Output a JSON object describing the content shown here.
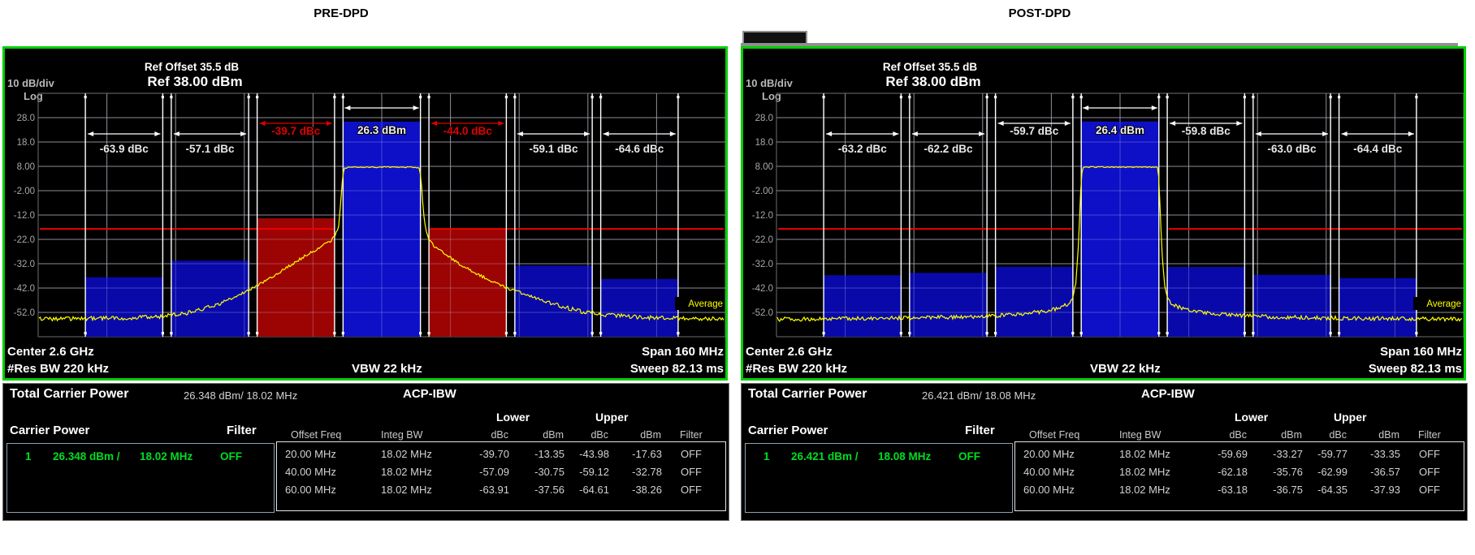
{
  "titles": {
    "left": "PRE-DPD",
    "right": "POST-DPD"
  },
  "panels": [
    {
      "name": "pre-dpd",
      "header": {
        "div_label": "10 dB/div",
        "scale_label": "Log",
        "ref_offset": "Ref Offset 35.5 dB",
        "ref": "Ref 38.00 dBm"
      },
      "y_ticks": [
        "28.0",
        "18.0",
        "8.00",
        "-2.00",
        "-12.0",
        "-22.0",
        "-32.0",
        "-42.0",
        "-52.0"
      ],
      "average_label": "Average",
      "footer": {
        "center": "Center  2.6 GHz",
        "res_bw": "#Res BW  220 kHz",
        "vbw": "VBW  22 kHz",
        "span": "Span 160 MHz",
        "sweep": "Sweep  82.13 ms"
      },
      "table": {
        "total_label": "Total Carrier Power",
        "total_value": "26.348 dBm/ 18.02 MHz",
        "acp_label": "ACP-IBW",
        "carrier_header": "Carrier Power",
        "filter_header": "Filter",
        "lower_header": "Lower",
        "upper_header": "Upper",
        "columns": [
          "Offset Freq",
          "Integ BW",
          "dBc",
          "dBm",
          "dBc",
          "dBm",
          "Filter"
        ],
        "carrier_row": {
          "index": "1",
          "power": "26.348 dBm /",
          "bw": "18.02 MHz",
          "filter": "OFF"
        },
        "rows": [
          [
            "20.00 MHz",
            "18.02 MHz",
            "-39.70",
            "-13.35",
            "-43.98",
            "-17.63",
            "OFF"
          ],
          [
            "40.00 MHz",
            "18.02 MHz",
            "-57.09",
            "-30.75",
            "-59.12",
            "-32.78",
            "OFF"
          ],
          [
            "60.00 MHz",
            "18.02 MHz",
            "-63.91",
            "-37.56",
            "-64.61",
            "-38.26",
            "OFF"
          ]
        ]
      }
    },
    {
      "name": "post-dpd",
      "header": {
        "div_label": "10 dB/div",
        "scale_label": "Log",
        "ref_offset": "Ref Offset 35.5 dB",
        "ref": "Ref 38.00 dBm"
      },
      "y_ticks": [
        "28.0",
        "18.0",
        "8.00",
        "-2.00",
        "-12.0",
        "-22.0",
        "-32.0",
        "-42.0",
        "-52.0"
      ],
      "average_label": "Average",
      "footer": {
        "center": "Center  2.6 GHz",
        "res_bw": "#Res BW  220 kHz",
        "vbw": "VBW  22 kHz",
        "span": "Span 160 MHz",
        "sweep": "Sweep  82.13 ms"
      },
      "table": {
        "total_label": "Total Carrier Power",
        "total_value": "26.421 dBm/ 18.08 MHz",
        "acp_label": "ACP-IBW",
        "carrier_header": "Carrier Power",
        "filter_header": "Filter",
        "lower_header": "Lower",
        "upper_header": "Upper",
        "columns": [
          "Offset Freq",
          "Integ BW",
          "dBc",
          "dBm",
          "dBc",
          "dBm",
          "Filter"
        ],
        "carrier_row": {
          "index": "1",
          "power": "26.421 dBm /",
          "bw": "18.08 MHz",
          "filter": "OFF"
        },
        "rows": [
          [
            "20.00 MHz",
            "18.02 MHz",
            "-59.69",
            "-33.27",
            "-59.77",
            "-33.35",
            "OFF"
          ],
          [
            "40.00 MHz",
            "18.02 MHz",
            "-62.18",
            "-35.76",
            "-62.99",
            "-36.57",
            "OFF"
          ],
          [
            "60.00 MHz",
            "18.02 MHz",
            "-63.18",
            "-36.75",
            "-64.35",
            "-37.93",
            "OFF"
          ]
        ]
      }
    }
  ],
  "chart_data": [
    {
      "type": "area",
      "title": "PRE-DPD ACP spectrum",
      "ref_dbm": 38.0,
      "db_per_div": 10,
      "span_mhz": 160,
      "center_freq": "2.6 GHz",
      "ylim": [
        -62,
        38
      ],
      "carrier": {
        "power_dbm": 26.348,
        "width_mhz": 18.02,
        "label": "26.3 dBm"
      },
      "offsets": [
        {
          "offset_mhz": -60,
          "label": "-63.9 dBc",
          "dbm": -37.56,
          "alarm": false
        },
        {
          "offset_mhz": -40,
          "label": "-57.1 dBc",
          "dbm": -30.75,
          "alarm": false
        },
        {
          "offset_mhz": -20,
          "label": "-39.7 dBc",
          "dbm": -13.35,
          "alarm": true
        },
        {
          "offset_mhz": 20,
          "label": "-44.0 dBc",
          "dbm": -17.63,
          "alarm": true
        },
        {
          "offset_mhz": 40,
          "label": "-59.1 dBc",
          "dbm": -32.78,
          "alarm": false
        },
        {
          "offset_mhz": 60,
          "label": "-64.6 dBc",
          "dbm": -38.26,
          "alarm": false
        }
      ],
      "limit_line_dbm": -17.7,
      "trace": [
        [
          -80,
          -54.8
        ],
        [
          -70,
          -54.5
        ],
        [
          -60,
          -54.3
        ],
        [
          -52,
          -53.8
        ],
        [
          -46,
          -52.5
        ],
        [
          -42,
          -51
        ],
        [
          -38,
          -48.5
        ],
        [
          -34,
          -45.5
        ],
        [
          -30,
          -42
        ],
        [
          -26,
          -38
        ],
        [
          -22,
          -33.5
        ],
        [
          -18,
          -29
        ],
        [
          -15,
          -26
        ],
        [
          -12,
          -22.8
        ],
        [
          -10.8,
          -20.5
        ],
        [
          -10,
          -16
        ],
        [
          -9.6,
          -8
        ],
        [
          -9.2,
          2
        ],
        [
          -8.8,
          7
        ],
        [
          -8,
          7.6
        ],
        [
          0,
          7.7
        ],
        [
          8,
          7.6
        ],
        [
          8.8,
          7
        ],
        [
          9.2,
          2
        ],
        [
          9.6,
          -8
        ],
        [
          10,
          -16
        ],
        [
          10.8,
          -21
        ],
        [
          12,
          -24.5
        ],
        [
          15,
          -28.5
        ],
        [
          18,
          -32
        ],
        [
          22,
          -36
        ],
        [
          26,
          -39.5
        ],
        [
          30,
          -42.5
        ],
        [
          34,
          -45
        ],
        [
          38,
          -47.5
        ],
        [
          42,
          -49.5
        ],
        [
          46,
          -51.5
        ],
        [
          52,
          -53
        ],
        [
          60,
          -54
        ],
        [
          70,
          -54.5
        ],
        [
          80,
          -54.8
        ]
      ]
    },
    {
      "type": "area",
      "title": "POST-DPD ACP spectrum",
      "ref_dbm": 38.0,
      "db_per_div": 10,
      "span_mhz": 160,
      "center_freq": "2.6 GHz",
      "ylim": [
        -62,
        38
      ],
      "carrier": {
        "power_dbm": 26.421,
        "width_mhz": 18.08,
        "label": "26.4 dBm"
      },
      "offsets": [
        {
          "offset_mhz": -60,
          "label": "-63.2 dBc",
          "dbm": -36.75,
          "alarm": false
        },
        {
          "offset_mhz": -40,
          "label": "-62.2 dBc",
          "dbm": -35.76,
          "alarm": false
        },
        {
          "offset_mhz": -20,
          "label": "-59.7 dBc",
          "dbm": -33.27,
          "alarm": false
        },
        {
          "offset_mhz": 20,
          "label": "-59.8 dBc",
          "dbm": -33.35,
          "alarm": false
        },
        {
          "offset_mhz": 40,
          "label": "-63.0 dBc",
          "dbm": -36.57,
          "alarm": false
        },
        {
          "offset_mhz": 60,
          "label": "-64.4 dBc",
          "dbm": -37.93,
          "alarm": false
        }
      ],
      "limit_line_dbm": -17.7,
      "trace": [
        [
          -80,
          -54.8
        ],
        [
          -60,
          -54.5
        ],
        [
          -45,
          -54.2
        ],
        [
          -35,
          -53.8
        ],
        [
          -28,
          -53.2
        ],
        [
          -22,
          -52.5
        ],
        [
          -17,
          -51.5
        ],
        [
          -14,
          -50
        ],
        [
          -12,
          -48.5
        ],
        [
          -11,
          -46
        ],
        [
          -10.3,
          -40
        ],
        [
          -9.8,
          -28
        ],
        [
          -9.4,
          -12
        ],
        [
          -9.05,
          3
        ],
        [
          -8.7,
          7.4
        ],
        [
          -8,
          7.7
        ],
        [
          0,
          7.7
        ],
        [
          8,
          7.7
        ],
        [
          8.7,
          7.4
        ],
        [
          9.05,
          3
        ],
        [
          9.4,
          -12
        ],
        [
          9.8,
          -28
        ],
        [
          10.3,
          -40
        ],
        [
          11,
          -46
        ],
        [
          12,
          -48.5
        ],
        [
          14,
          -50
        ],
        [
          17,
          -51.5
        ],
        [
          22,
          -52.5
        ],
        [
          28,
          -53.2
        ],
        [
          35,
          -53.8
        ],
        [
          45,
          -54.2
        ],
        [
          60,
          -54.5
        ],
        [
          80,
          -54.8
        ]
      ]
    }
  ],
  "colors": {
    "border_green": "#00cf00",
    "bar_blue": "#0909aa",
    "carrier_blue": "#0d10c6",
    "bar_red": "#9c0404",
    "alarm_red": "#e00000",
    "trace_yellow": "#ffff00",
    "grid_gray": "#6e6e6e",
    "text_green": "#00dd22"
  }
}
